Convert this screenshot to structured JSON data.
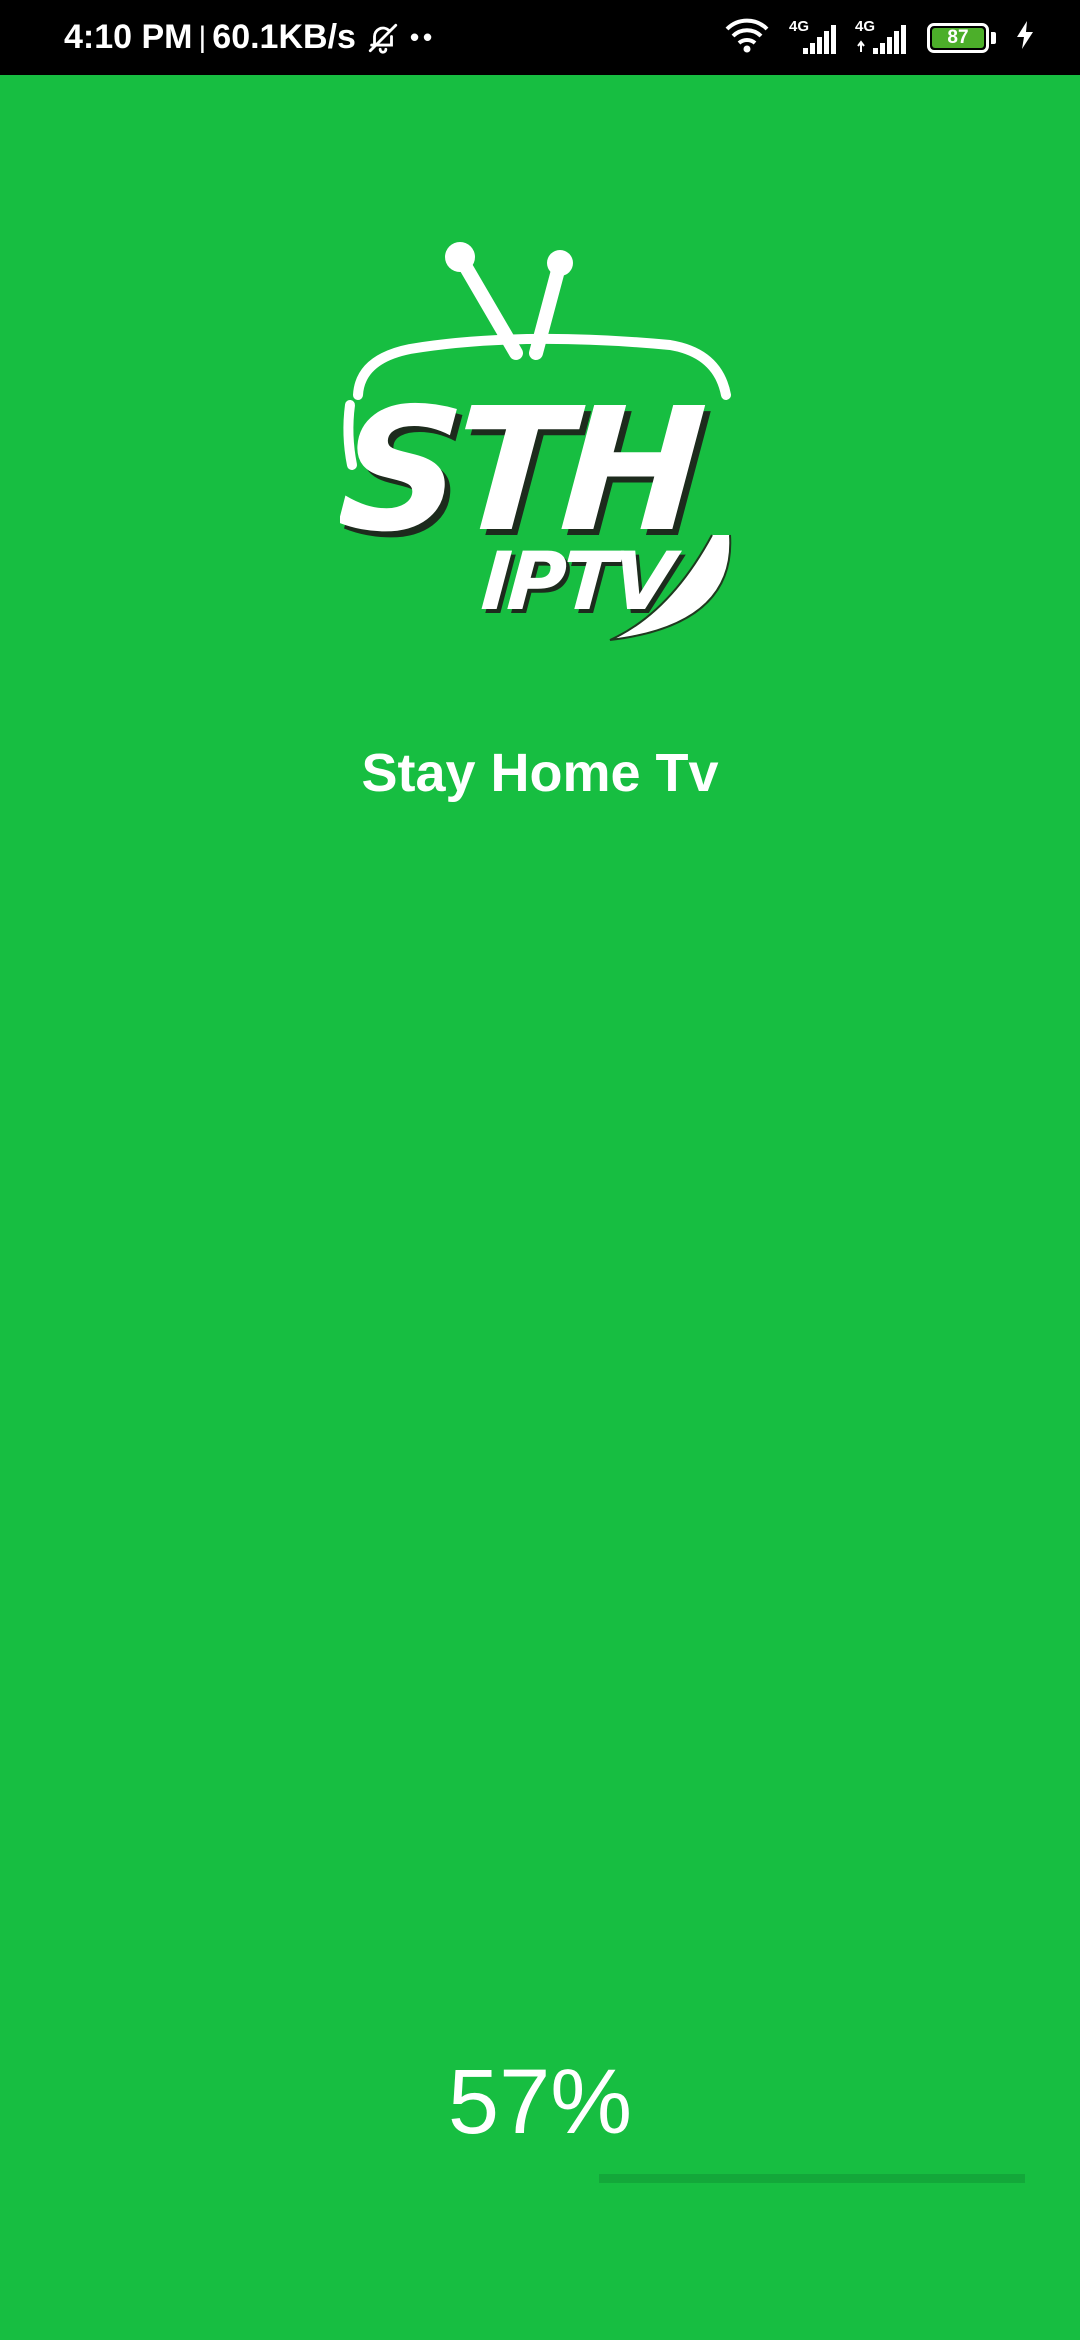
{
  "status_bar": {
    "time": "4:10 PM",
    "separator": "|",
    "network_speed": "60.1KB/s",
    "icons": [
      "bell-off-icon",
      "wifi-icon",
      "signal-4g-icon",
      "signal-4g-icon",
      "battery-icon",
      "charging-icon"
    ],
    "sim1_label": "4G",
    "sim2_label": "4G",
    "battery_level": "87"
  },
  "splash": {
    "logo_text_main": "STH",
    "logo_text_sub": "IPTV",
    "app_name": "Stay Home Tv",
    "progress_text": "57%",
    "progress_value": 0.57
  },
  "colors": {
    "background": "#17BE41",
    "status_bar": "#000000",
    "text": "#FFFFFF",
    "progress_track": "#13A83A"
  }
}
